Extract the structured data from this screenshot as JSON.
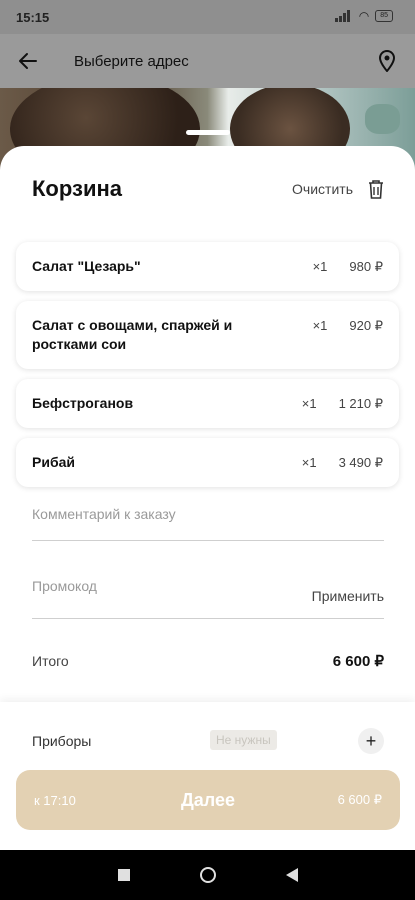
{
  "status": {
    "time": "15:15",
    "battery": "85"
  },
  "appbar": {
    "title": "Выберите адрес"
  },
  "cart": {
    "title": "Корзина",
    "clear_label": "Очистить",
    "items": [
      {
        "name": "Салат \"Цезарь\"",
        "qty": "×1",
        "price": "980 ₽"
      },
      {
        "name": "Салат с овощами, спаржей и ростками сои",
        "qty": "×1",
        "price": "920 ₽"
      },
      {
        "name": "Бефстроганов",
        "qty": "×1",
        "price": "1 210 ₽"
      },
      {
        "name": "Рибай",
        "qty": "×1",
        "price": "3 490 ₽"
      }
    ],
    "comment_placeholder": "Комментарий к заказу",
    "promo_placeholder": "Промокод",
    "promo_apply": "Применить",
    "total_label": "Итого",
    "total_value": "6 600 ₽"
  },
  "bottom": {
    "cutlery_label": "Приборы",
    "cutlery_badge": "Не нужны",
    "cta_eta": "к 17:10",
    "cta_label": "Далее",
    "cta_sum": "6 600 ₽"
  },
  "colors": {
    "accent": "#e3d1b3"
  }
}
